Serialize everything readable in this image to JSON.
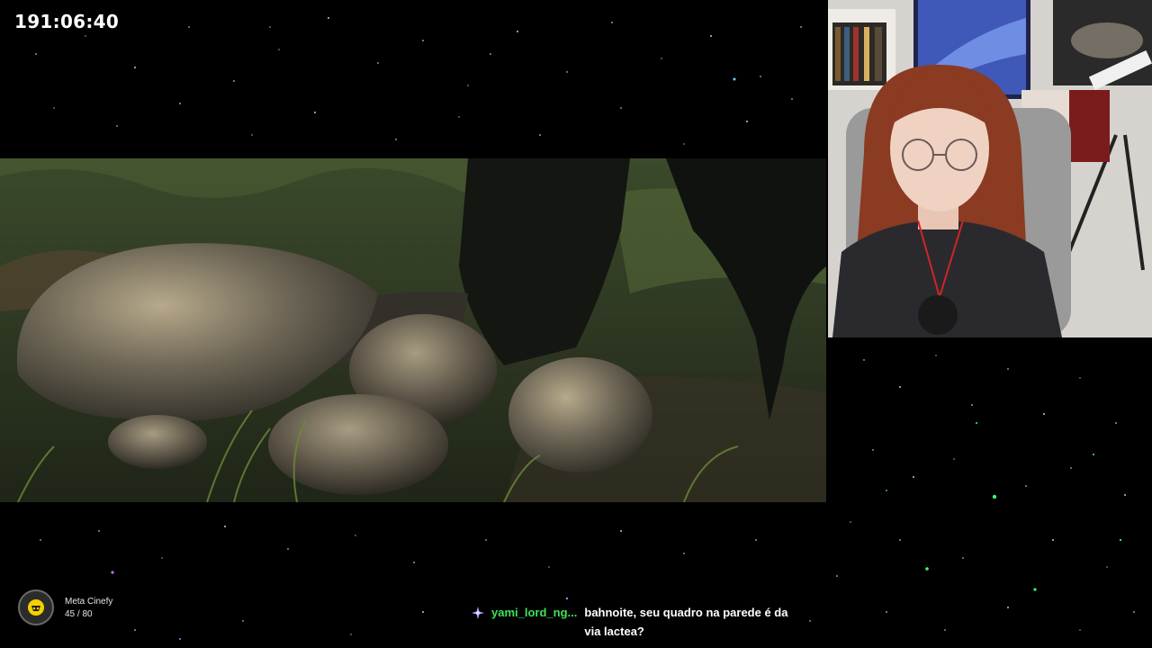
{
  "stream": {
    "timer": "191:06:40"
  },
  "video": {
    "scene": "movie-frame-rocks-on-grass"
  },
  "webcam": {
    "scene": "streamer-webcam"
  },
  "goal": {
    "title": "Meta Cinefy",
    "count": "45 / 80",
    "progress": 0.5625,
    "icon": "cinefy-logo-icon",
    "accent": "#f5d000"
  },
  "chat": {
    "badge_icon": "sparkle-badge-icon",
    "username": "yami_lord_ng...",
    "username_color": "#3fe35a",
    "message": "bahnoite, seu quadro na parede é da via lactea?"
  }
}
